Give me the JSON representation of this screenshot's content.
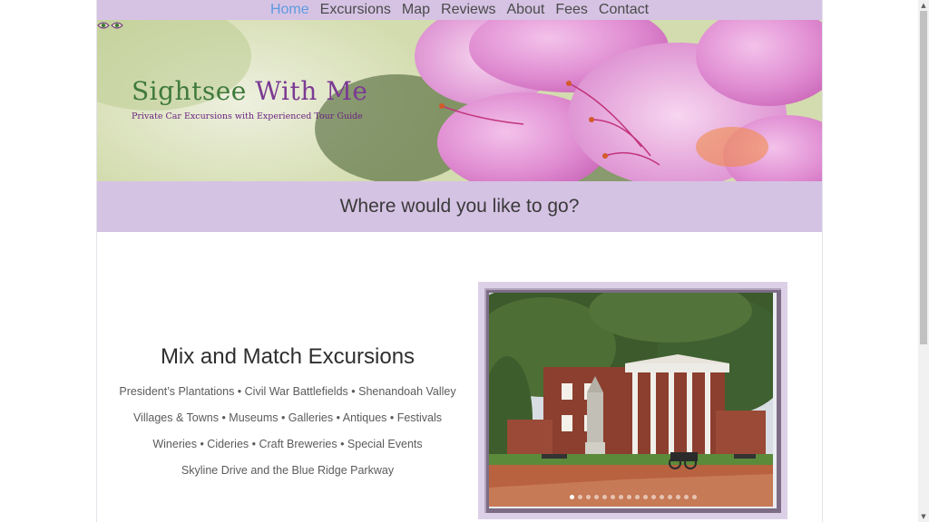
{
  "nav": {
    "items": [
      {
        "label": "Home",
        "active": true
      },
      {
        "label": "Excursions"
      },
      {
        "label": "Map"
      },
      {
        "label": "Reviews"
      },
      {
        "label": "About"
      },
      {
        "label": "Fees"
      },
      {
        "label": "Contact"
      }
    ]
  },
  "brand": {
    "title_part1": "Sightsee",
    "title_part2": "With Me",
    "tagline": "Private Car Excursions with Experienced Tour Guide"
  },
  "banner": {
    "text": "Where would you like to go?"
  },
  "main": {
    "heading": "Mix and Match Excursions",
    "lines": [
      "President’s Plantations • Civil War Battlefields • Shenandoah Valley",
      "Villages & Towns • Museums • Galleries • Antiques • Festivals",
      "Wineries • Cideries • Craft Breweries • Special Events",
      "Skyline Drive and the Blue Ridge Parkway"
    ]
  },
  "slideshow": {
    "dot_count": 16,
    "active_index": 0
  },
  "colors": {
    "nav_bg": "#d6c3e4",
    "banner_bg": "#d5c3e4",
    "active_link": "#5e9be0",
    "title_green": "#3f7a3b",
    "title_purple": "#7b3a93"
  }
}
